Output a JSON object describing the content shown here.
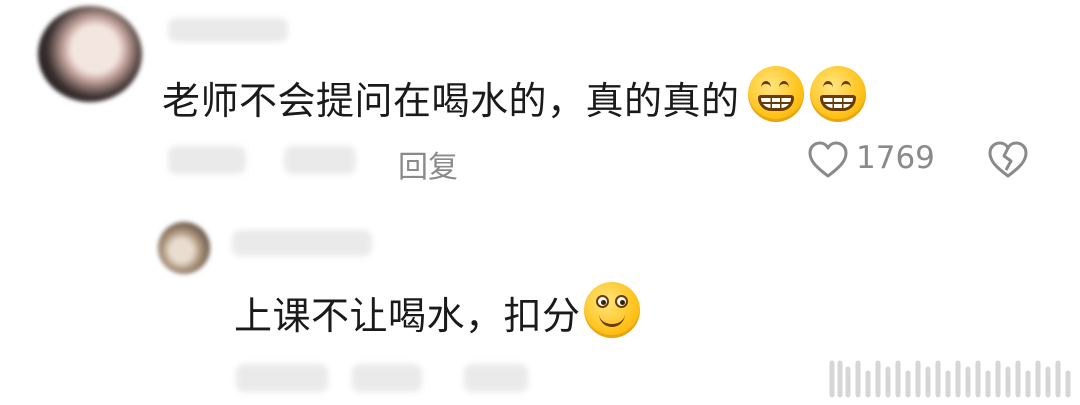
{
  "comments": {
    "main": {
      "text": "老师不会提问在喝水的，真的真的",
      "emojis": [
        "grin-emoji",
        "grin-emoji"
      ],
      "reply_label": "回复",
      "like_count": "1769"
    },
    "reply": {
      "text": "上课不让喝水，扣分",
      "emojis": [
        "smile-emoji"
      ]
    }
  },
  "colors": {
    "text": "#1a1a1a",
    "muted": "#8a8a8a",
    "emoji": "#ffc21a"
  }
}
